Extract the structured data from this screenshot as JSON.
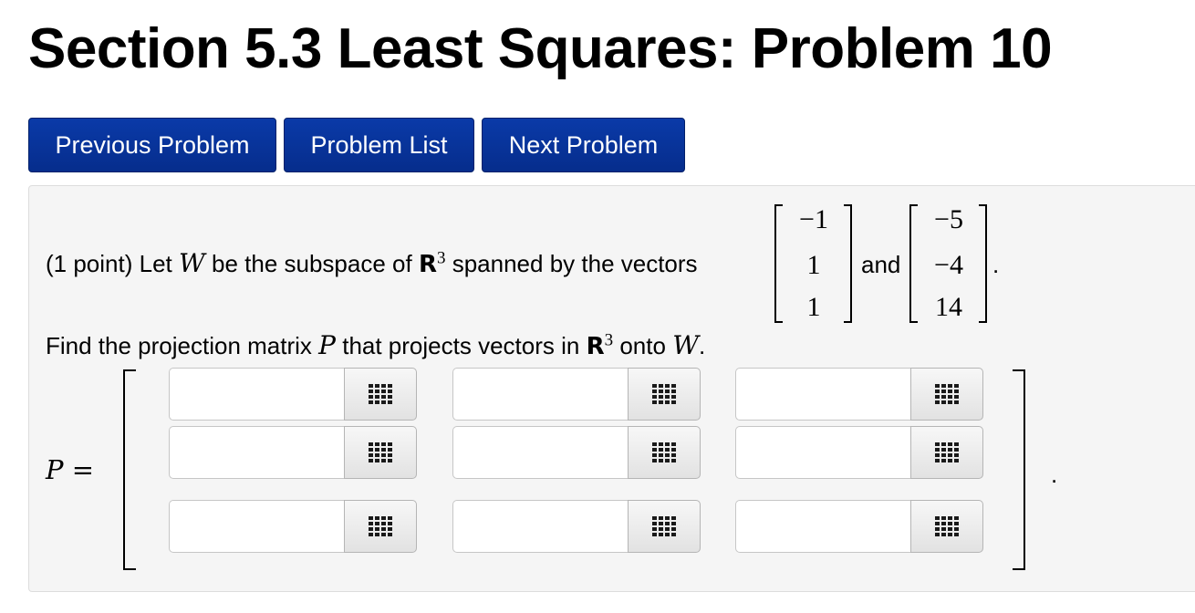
{
  "page": {
    "title": "Section 5.3 Least Squares: Problem 10"
  },
  "nav": {
    "previous": "Previous Problem",
    "list": "Problem List",
    "next": "Next Problem"
  },
  "problem": {
    "points": "(1 point) Let",
    "var_w": "W",
    "text_subspace": "be the subspace of",
    "space": "R",
    "exponent": "3",
    "text_spanned": "spanned by the vectors",
    "vector1": [
      "−1",
      "1",
      "1"
    ],
    "and": "and",
    "vector2": [
      "−5",
      "−4",
      "14"
    ],
    "period": ".",
    "find_text": "Find the projection matrix",
    "var_p": "P",
    "find_text2": "that projects vectors in",
    "onto": "onto",
    "answer_label": "P =",
    "matrix_period": "."
  },
  "matrix": {
    "rows": [
      [
        "",
        "",
        ""
      ],
      [
        "",
        "",
        ""
      ],
      [
        "",
        "",
        ""
      ]
    ],
    "button_icon": "grid-icon"
  }
}
